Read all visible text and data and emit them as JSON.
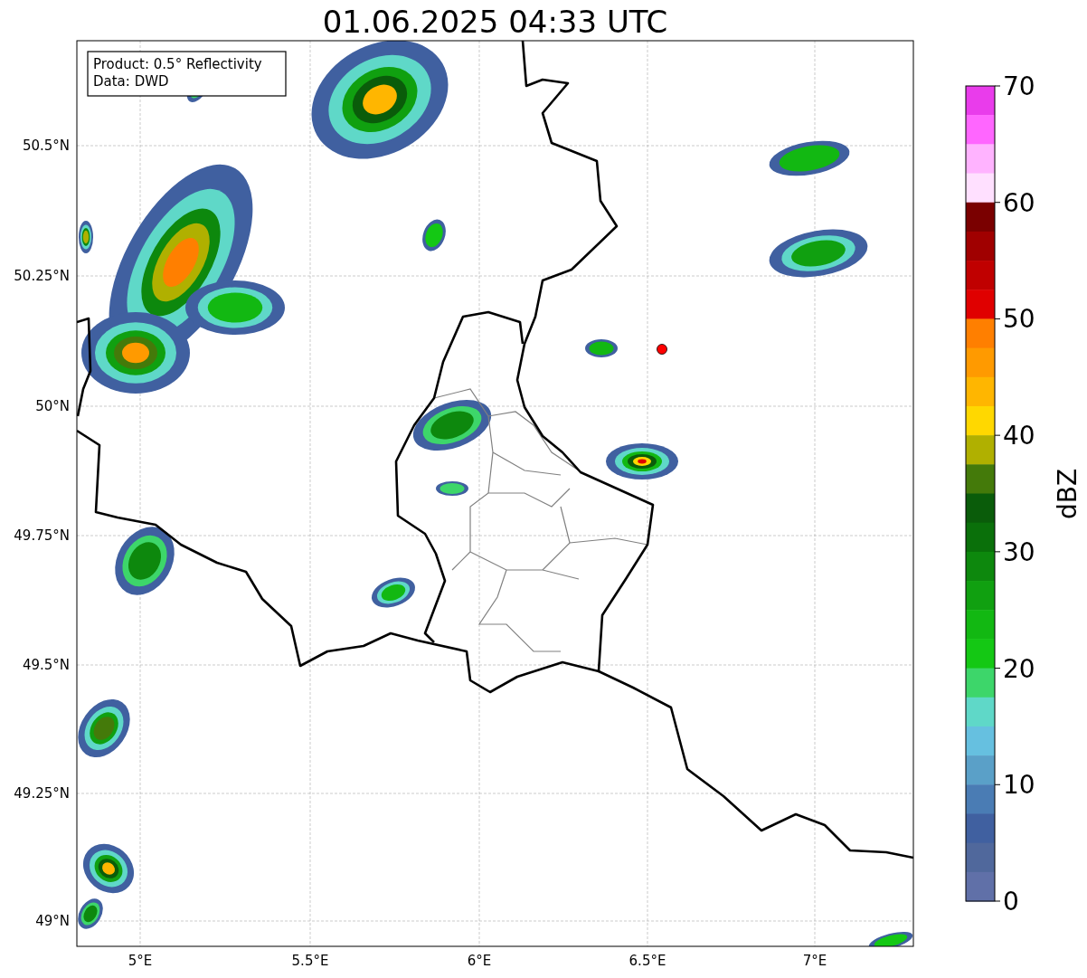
{
  "title": "01.06.2025 04:33 UTC",
  "info_box": [
    "Product: 0.5° Reflectivity",
    "Data: DWD"
  ],
  "lat_labels": [
    "50.5°N",
    "50.25°N",
    "50°N",
    "49.75°N",
    "49.5°N",
    "49.25°N",
    "49°N"
  ],
  "lon_labels": [
    "5°E",
    "5.5°E",
    "6°E",
    "6.5°E",
    "7°E"
  ],
  "colorbar": {
    "label": "dBZ",
    "ticks": [
      "70",
      "60",
      "50",
      "40",
      "30",
      "20",
      "10",
      "0"
    ],
    "bins": [
      {
        "color": "#e93ceb"
      },
      {
        "color": "#ff66ff"
      },
      {
        "color": "#ffb3ff"
      },
      {
        "color": "#ffe0ff"
      },
      {
        "color": "#7a0000"
      },
      {
        "color": "#a00000"
      },
      {
        "color": "#c00000"
      },
      {
        "color": "#e00000"
      },
      {
        "color": "#ff7f00"
      },
      {
        "color": "#ff9a00"
      },
      {
        "color": "#ffb600"
      },
      {
        "color": "#ffd800"
      },
      {
        "color": "#b0b000"
      },
      {
        "color": "#447a0a"
      },
      {
        "color": "#0a5c0a"
      },
      {
        "color": "#0a700a"
      },
      {
        "color": "#0d880d"
      },
      {
        "color": "#10a010"
      },
      {
        "color": "#12b812"
      },
      {
        "color": "#14c814"
      },
      {
        "color": "#3dd66a"
      },
      {
        "color": "#5fd8c8"
      },
      {
        "color": "#66c0e0"
      },
      {
        "color": "#5aa0c8"
      },
      {
        "color": "#4a7cb4"
      },
      {
        "color": "#4060a0"
      },
      {
        "color": "#50689c"
      },
      {
        "color": "#6070a8"
      }
    ]
  }
}
